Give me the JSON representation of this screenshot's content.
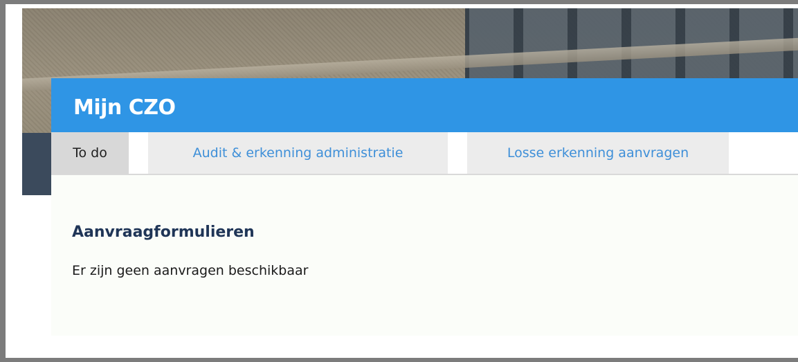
{
  "header": {
    "title": "Mijn CZO"
  },
  "tabs": [
    {
      "label": "To do",
      "active": true
    },
    {
      "label": "Audit & erkenning administratie",
      "active": false
    },
    {
      "label": "Losse erkenning aanvragen",
      "active": false
    }
  ],
  "main": {
    "section_title": "Aanvraagformulieren",
    "empty_message": "Er zijn geen aanvragen beschikbaar"
  },
  "colors": {
    "header_bg": "#2f95e5",
    "tab_link": "#3e8fd8",
    "section_title": "#1f3557"
  }
}
